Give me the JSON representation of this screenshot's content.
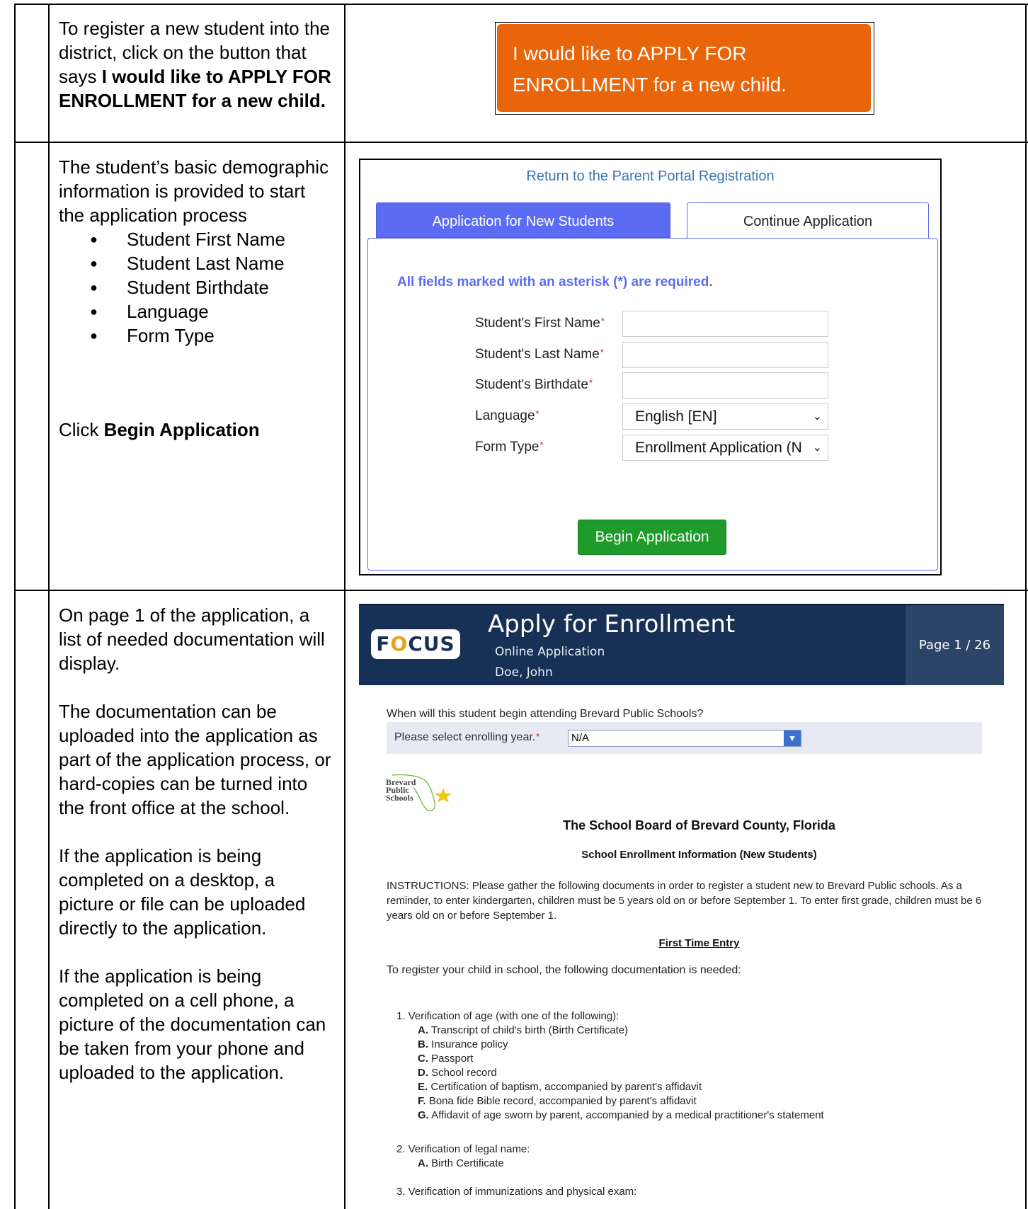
{
  "rows": [
    {
      "description": {
        "prefix": "To register a new student into the district, click on the button that says ",
        "bold": "I would like to APPLY FOR ENROLLMENT for a new child."
      },
      "apply_button": {
        "line1": "I would like to APPLY FOR",
        "line2": "ENROLLMENT for a new child."
      }
    },
    {
      "description": {
        "intro": "The student’s basic demographic information is provided to start the application process",
        "bullets": [
          "Student First Name",
          "Student Last Name",
          "Student Birthdate",
          "Language",
          "Form Type"
        ],
        "click_prefix": "Click ",
        "click_bold": "Begin Application"
      }
    },
    {
      "description": {
        "p1": "On page 1 of the application, a list of needed documentation will display.",
        "p2": "The documentation can be uploaded into the application as part of the application process, or hard-copies can be turned into the front office at the school.",
        "p3": "If the application is being completed on a desktop, a picture or file can be uploaded directly to the application.",
        "p4": "If the application is being completed on a cell phone, a picture of the documentation can be taken from your phone and uploaded to the application."
      }
    }
  ],
  "form": {
    "return_link": "Return to the Parent Portal Registration",
    "tab_new": "Application for New Students",
    "tab_continue": "Continue Application",
    "required_note": "All fields marked with an asterisk (*) are required.",
    "fields": [
      {
        "label": "Student's First Name",
        "value": ""
      },
      {
        "label": "Student's Last Name",
        "value": ""
      },
      {
        "label": "Student's Birthdate",
        "value": ""
      },
      {
        "label": "Language",
        "value": "English [EN]"
      },
      {
        "label": "Form Type",
        "value": "Enrollment Application (N"
      }
    ],
    "asterisk": "*",
    "begin_button": "Begin Application"
  },
  "focus": {
    "logo": {
      "f": "F",
      "o": "O",
      "cus": "CUS"
    },
    "title": "Apply for Enrollment",
    "subtitle": "Online Application",
    "student_name": "Doe, John",
    "page_indicator": "Page 1 / 26",
    "question": "When will this student begin attending Brevard Public Schools?",
    "enroll_label": "Please select enrolling year.",
    "enroll_value": "N/A",
    "bps_logo": [
      "Brevard",
      "Public",
      "Schools"
    ],
    "board_title": "The School Board of Brevard County, Florida",
    "section_title": "School Enrollment Information (New Students)",
    "instructions": "INSTRUCTIONS: Please gather the following documents in order to register a student new to Brevard Public schools. As a reminder, to enter kindergarten, children must be 5 years old on or before September 1. To enter first grade, children must be 6 years old on or before September 1.",
    "first_time_entry": "First Time Entry",
    "needed_text": "To register your child in school, the following documentation is needed:",
    "doc1_title": "1. Verification of age (with one of the following):",
    "doc1_items": [
      {
        "letter": "A.",
        "text": " Transcript of child's birth (Birth Certificate)"
      },
      {
        "letter": "B.",
        "text": " Insurance policy"
      },
      {
        "letter": "C.",
        "text": " Passport"
      },
      {
        "letter": "D.",
        "text": " School record"
      },
      {
        "letter": "E.",
        "text": " Certification of baptism, accompanied by parent's affidavit"
      },
      {
        "letter": "F.",
        "text": " Bona fide Bible record, accompanied by parent's affidavit"
      },
      {
        "letter": "G.",
        "text": " Affidavit of age sworn by parent, accompanied by a medical practitioner's statement"
      }
    ],
    "doc2_title": "2. Verification of legal name:",
    "doc2_items": [
      {
        "letter": "A.",
        "text": " Birth Certificate"
      }
    ],
    "doc3_title": "3. Verification of immunizations and physical exam:"
  },
  "colors": {
    "apply_orange": "#e8650a",
    "tab_blue": "#5c6cf2",
    "begin_green": "#1e9b2b",
    "focus_navy": "#173055"
  }
}
